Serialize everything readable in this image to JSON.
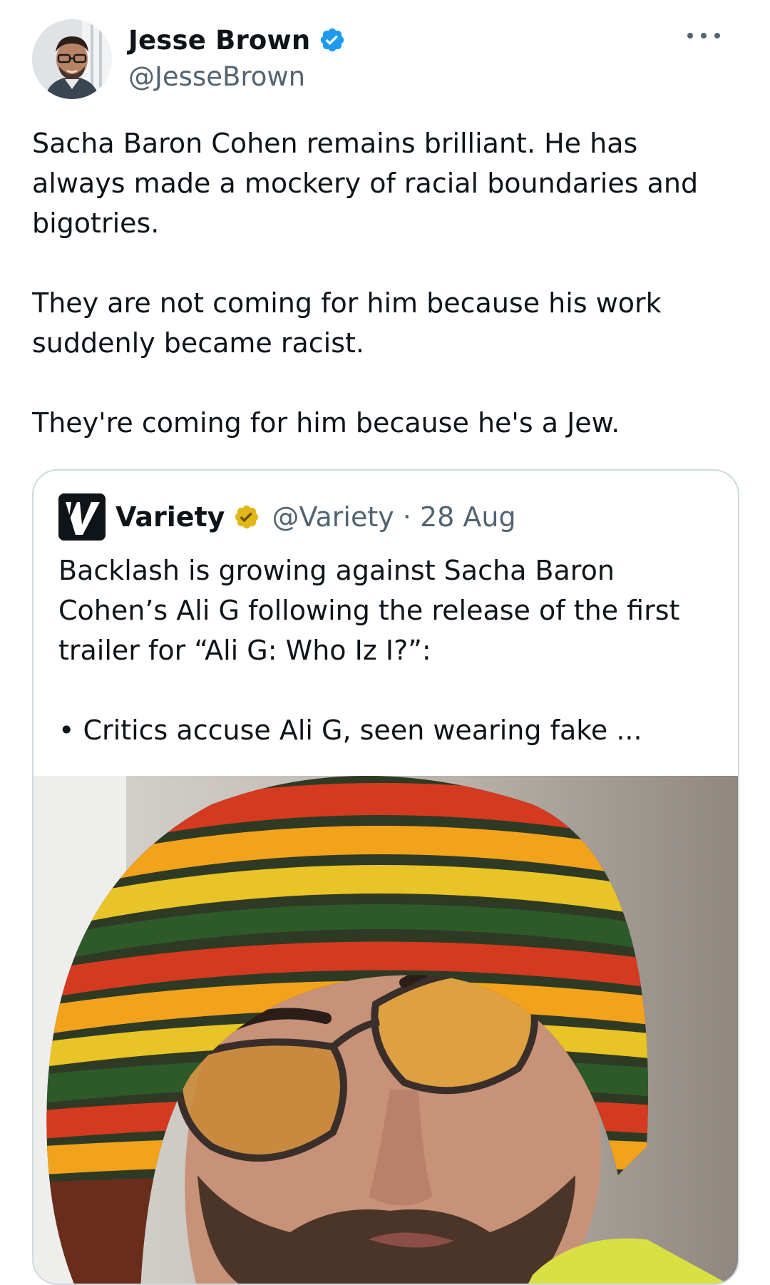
{
  "tweet": {
    "author": {
      "display_name": "Jesse Brown",
      "handle": "@JesseBrown",
      "verified": true,
      "verified_color": "#1d9bf0"
    },
    "more_icon": "more-horizontal-icon",
    "paragraphs": [
      "Sacha Baron Cohen remains brilliant. He has always made a mockery of racial boundaries and bigotries.",
      "They are not coming for him because his work suddenly became racist.",
      "They're coming for him because he's a Jew."
    ]
  },
  "quote": {
    "logo_icon": "variety-logo-icon",
    "display_name": "Variety",
    "badge_icon": "gold-verified-badge-icon",
    "badge_color": "#e2b719",
    "meta": "@Variety · 28 Aug",
    "paragraphs": [
      "Backlash is growing against Sacha Baron Cohen’s Ali G following the release of the first trailer for “Ali G: Who Iz I?”:",
      "• Critics accuse Ali G, seen wearing fake ..."
    ],
    "media_icon": "photo-man-in-rasta-hat-icon"
  },
  "colors": {
    "text_primary": "#0f1419",
    "text_secondary": "#536471",
    "border": "#cfd9de"
  }
}
